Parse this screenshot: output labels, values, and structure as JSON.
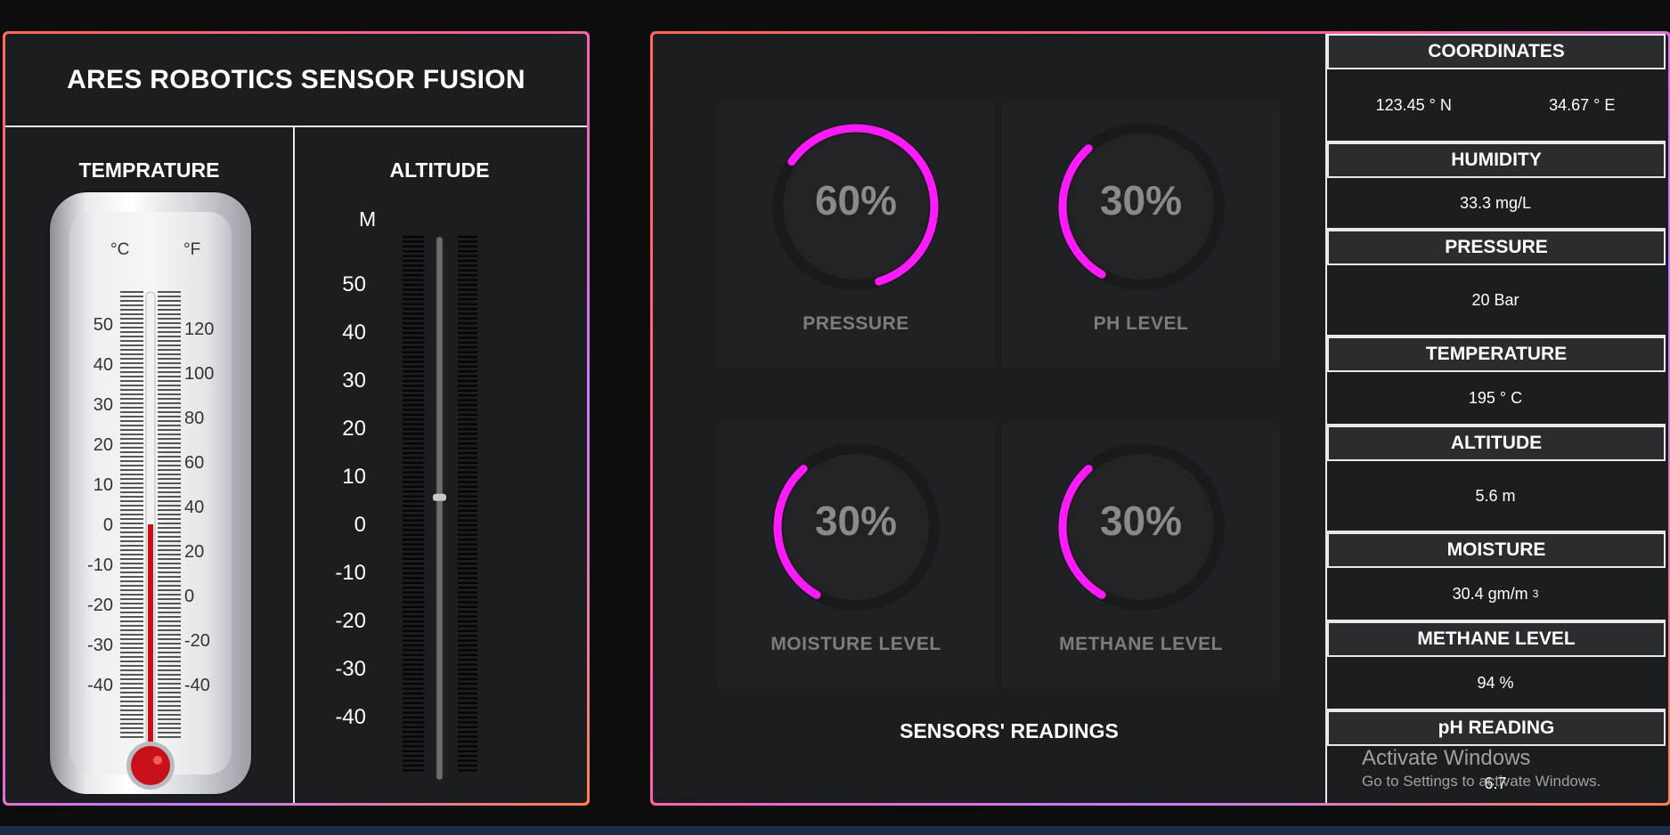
{
  "app": {
    "title": "ARES ROBOTICS SENSOR FUSION"
  },
  "temperature_panel": {
    "title": "TEMPRATURE",
    "unit_c": "°C",
    "unit_f": "°F",
    "c_ticks": [
      "50",
      "40",
      "30",
      "20",
      "10",
      "0",
      "-10",
      "-20",
      "-30",
      "-40"
    ],
    "f_ticks": [
      "120",
      "100",
      "80",
      "60",
      "40",
      "20",
      "0",
      "-20",
      "-40"
    ],
    "mercury_level_c": 0
  },
  "altitude_panel": {
    "title": "ALTITUDE",
    "unit": "M",
    "ticks": [
      "50",
      "40",
      "30",
      "20",
      "10",
      "0",
      "-10",
      "-20",
      "-30",
      "-40"
    ],
    "value_m": 5.6
  },
  "gauges": [
    {
      "label": "PRESSURE",
      "value_text": "60%",
      "value": 60
    },
    {
      "label": "PH LEVEL",
      "value_text": "30%",
      "value": 30
    },
    {
      "label": "MOISTURE LEVEL",
      "value_text": "30%",
      "value": 30
    },
    {
      "label": "METHANE LEVEL",
      "value_text": "30%",
      "value": 30
    }
  ],
  "sensors_title": "SENSORS' READINGS",
  "readings": {
    "coordinates": {
      "label": "COORDINATES",
      "lat": "123.45 ° N",
      "lon": "34.67 ° E"
    },
    "humidity": {
      "label": "HUMIDITY",
      "value": "33.3 mg/L"
    },
    "pressure": {
      "label": "PRESSURE",
      "value": "20 Bar"
    },
    "temperature": {
      "label": "TEMPERATURE",
      "value": "195 ° C"
    },
    "altitude": {
      "label": "ALTITUDE",
      "value": "5.6 m"
    },
    "moisture": {
      "label": "MOISTURE",
      "value": "30.4 gm/m",
      "sup": "3"
    },
    "methane": {
      "label": "METHANE LEVEL",
      "value": "94 %"
    },
    "ph": {
      "label": "pH READING",
      "value": "6.7"
    }
  },
  "watermark": {
    "line1": "Activate Windows",
    "line2": "Go to Settings to activate Windows."
  },
  "colors": {
    "accent": "#ff1aff",
    "mercury": "#c8101a",
    "panel": "#1c1d20"
  }
}
